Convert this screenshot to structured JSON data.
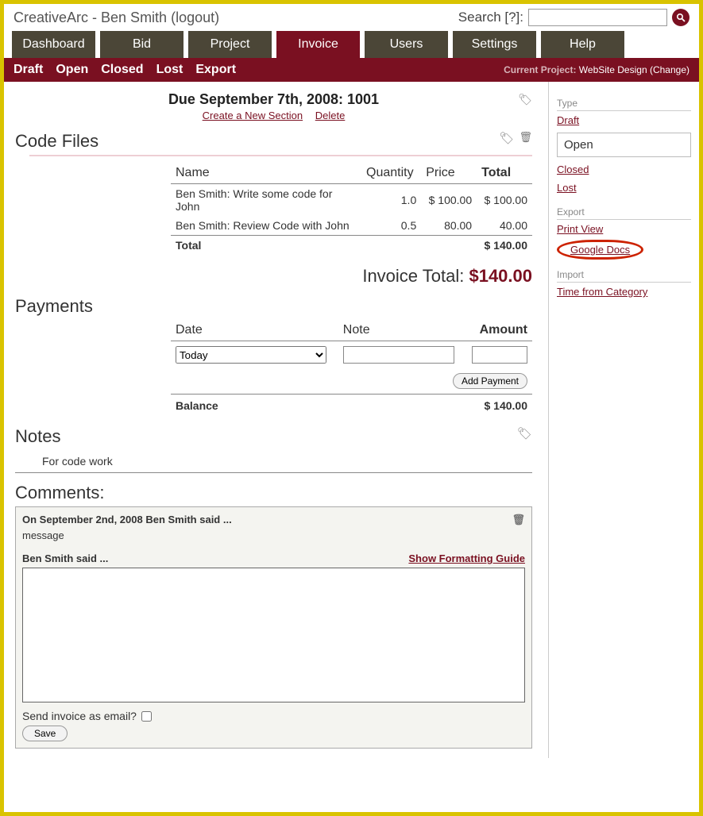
{
  "header": {
    "brand": "CreativeArc",
    "dash": " - ",
    "user": "Ben Smith",
    "logout": " (logout)",
    "search_label": "Search [?]:"
  },
  "tabs": [
    "Dashboard",
    "Bid",
    "Project",
    "Invoice",
    "Users",
    "Settings",
    "Help"
  ],
  "active_tab": "Invoice",
  "subnav": {
    "items": [
      "Draft",
      "Open",
      "Closed",
      "Lost",
      "Export"
    ],
    "current_project_label": "Current Project:",
    "current_project": "WebSite Design",
    "change": "(Change)"
  },
  "due": {
    "line": "Due September 7th, 2008: 1001",
    "create_section": "Create a New Section",
    "delete": "Delete"
  },
  "code_files": {
    "heading": "Code Files",
    "cols": {
      "name": "Name",
      "qty": "Quantity",
      "price": "Price",
      "total": "Total"
    },
    "rows": [
      {
        "desc": "Ben Smith: Write some code for John",
        "qty": "1.0",
        "price": "$ 100.00",
        "total": "$  100.00"
      },
      {
        "desc": "Ben Smith: Review Code with John",
        "qty": "0.5",
        "price": "80.00",
        "total": "40.00"
      }
    ],
    "total_label": "Total",
    "total_value": "$ 140.00"
  },
  "invoice_total": {
    "label": "Invoice Total:",
    "value": "$140.00"
  },
  "payments": {
    "heading": "Payments",
    "cols": {
      "date": "Date",
      "note": "Note",
      "amount": "Amount"
    },
    "date_option": "Today",
    "add_btn": "Add Payment",
    "balance_label": "Balance",
    "balance_value": "$ 140.00"
  },
  "notes": {
    "heading": "Notes",
    "text": "For code work"
  },
  "comments": {
    "heading": "Comments:",
    "prev_header": "On September 2nd, 2008 Ben Smith said ...",
    "prev_msg": "message",
    "said": "Ben Smith said ...",
    "fmt_guide": "Show Formatting Guide",
    "send_label": "Send invoice as email?",
    "save": "Save"
  },
  "sidebar": {
    "type_heading": "Type",
    "type_links": {
      "draft": "Draft",
      "open": "Open",
      "closed": "Closed",
      "lost": "Lost"
    },
    "export_heading": "Export",
    "export_links": {
      "print": "Print View",
      "gdocs": "Google Docs"
    },
    "import_heading": "Import",
    "import_link": "Time from Category"
  }
}
